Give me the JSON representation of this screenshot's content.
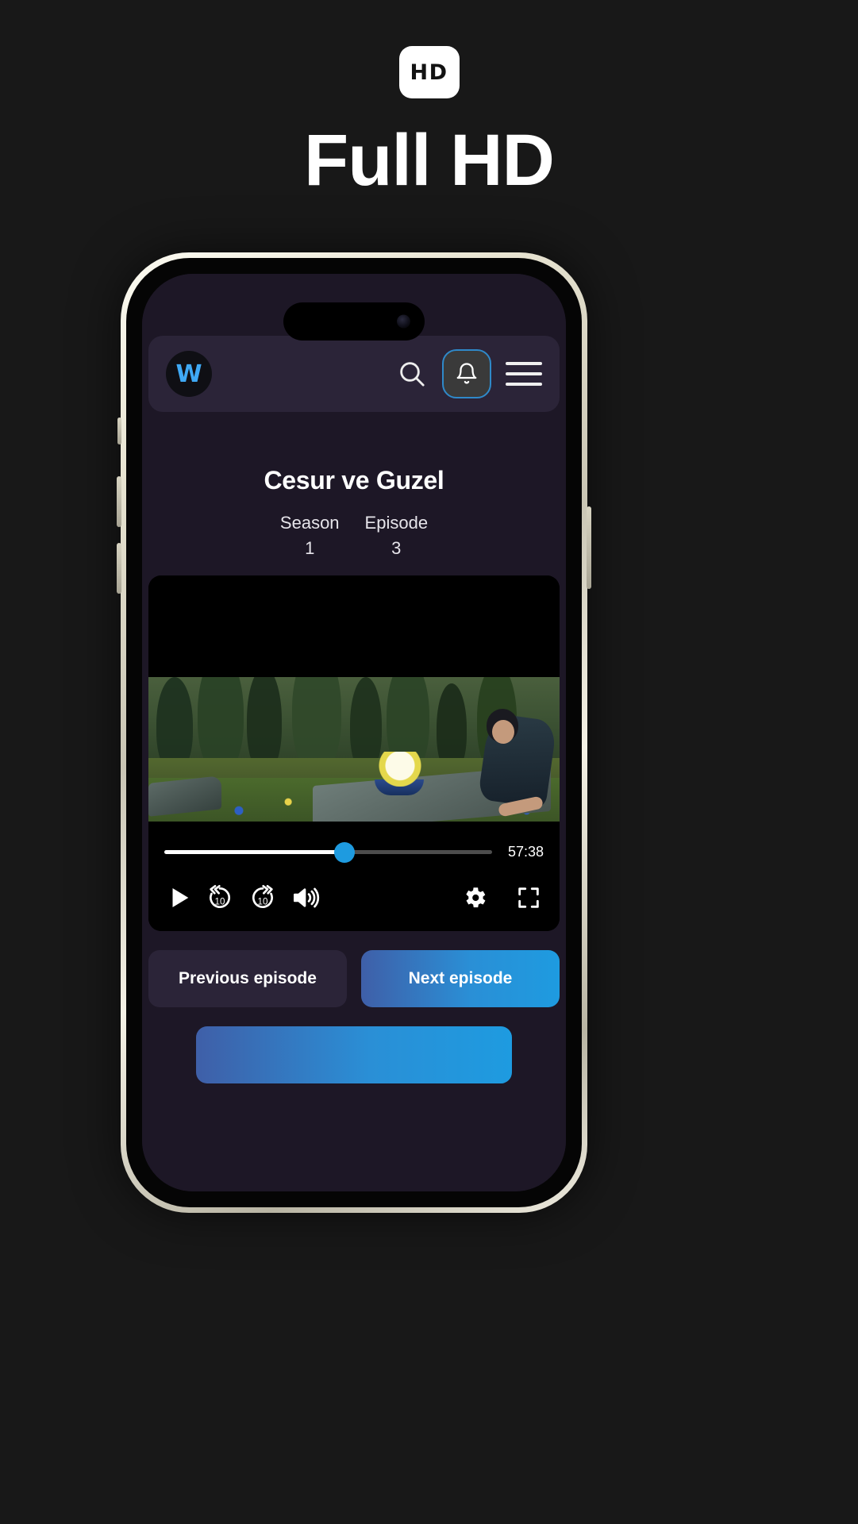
{
  "promo": {
    "badge_text": "HD",
    "headline": "Full HD"
  },
  "colors": {
    "page_background": "#181818",
    "app_background": "#1d1726",
    "navbar": "#2b2438",
    "accent_blue": "#1e9be0",
    "logo_blue": "#3fa9f5",
    "badge_white": "#ffffff"
  },
  "app": {
    "navbar": {
      "logo_letter": "W",
      "search_icon": "search-icon",
      "notifications_icon": "bell-icon",
      "menu_icon": "hamburger-menu-icon"
    },
    "content": {
      "show_title": "Cesur ve Guzel",
      "season_label": "Season",
      "season_value": "1",
      "episode_label": "Episode",
      "episode_value": "3"
    },
    "player": {
      "current_time": "57:38",
      "progress_percent": 55,
      "play_icon": "play-icon",
      "rewind_label": "10",
      "forward_label": "10",
      "volume_icon": "volume-icon",
      "settings_icon": "gear-icon",
      "fullscreen_icon": "fullscreen-icon"
    },
    "episode_nav": {
      "previous_label": "Previous episode",
      "next_label": "Next episode"
    }
  }
}
